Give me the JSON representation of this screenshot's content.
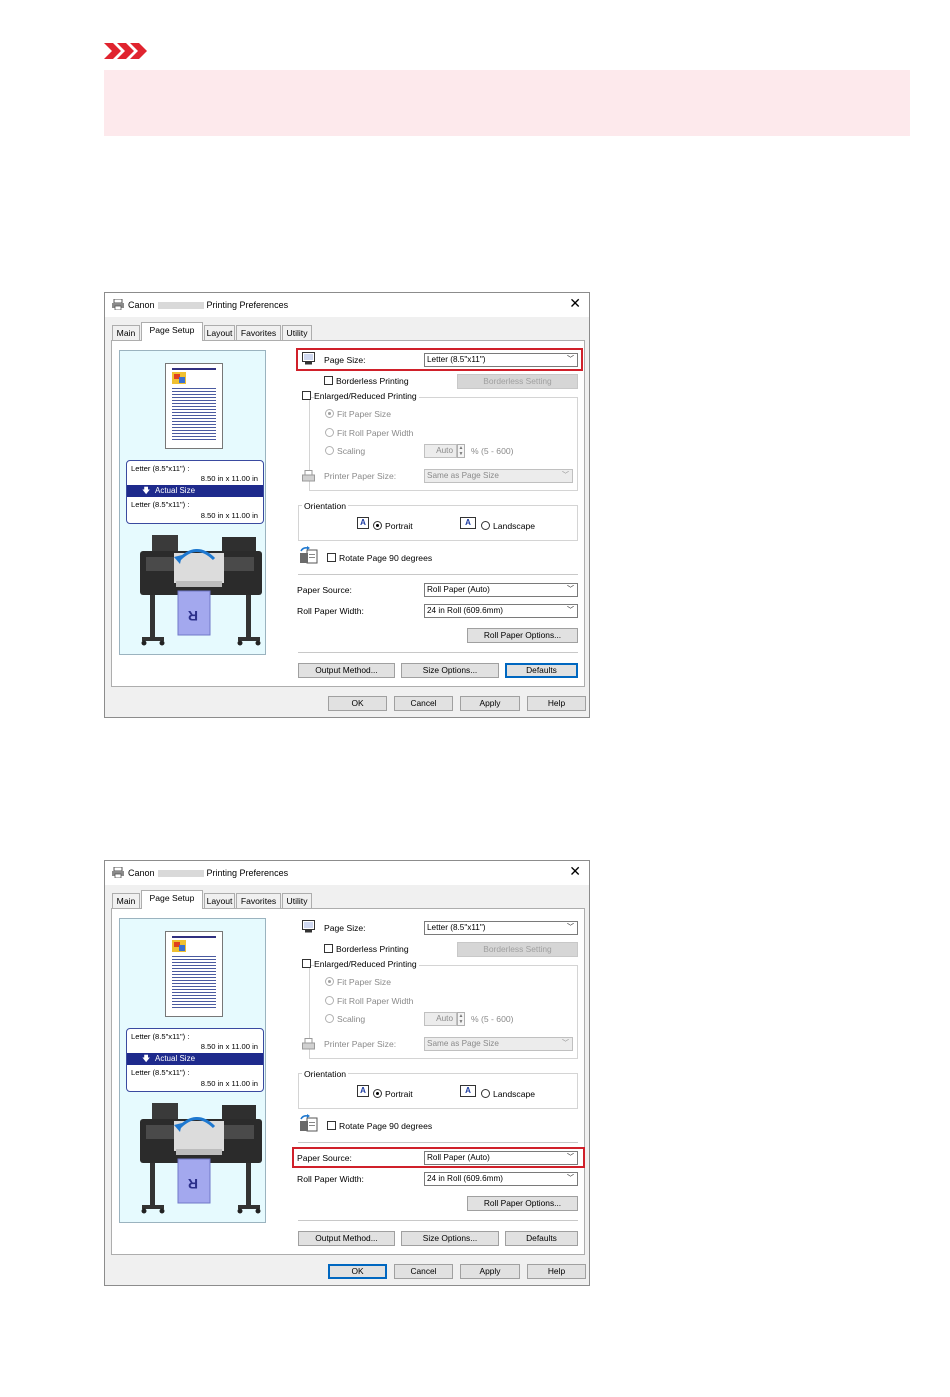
{
  "colors": {
    "note_bg": "#fde9ec",
    "note_icon": "#e0242f",
    "highlight": "#d0202a",
    "preview_bg": "#e6fafe",
    "accent": "#1e2a8c"
  },
  "icons": {
    "note": "important-chevrons-icon",
    "printer": "printer-icon",
    "close": "close-icon",
    "page_size": "monitor-icon",
    "orientation": "letter-a-icon",
    "rotate": "rotate-page-icon",
    "dropdown": "chevron-down-icon"
  },
  "dialog": {
    "title_prefix": "Canon",
    "title_suffix": "Printing Preferences",
    "close_glyph": "✕",
    "tabs": [
      "Main",
      "Page Setup",
      "Layout",
      "Favorites",
      "Utility"
    ],
    "active_tab": "Page Setup",
    "preview": {
      "line1": "Letter (8.5\"x11\") :",
      "line2": "8.50 in x 11.00 in",
      "bar_arrow": "🡇",
      "bar_label": "Actual Size",
      "line3": "Letter (8.5\"x11\") :",
      "line4": "8.50 in x 11.00 in"
    },
    "page_size_label": "Page Size:",
    "page_size_value": "Letter (8.5\"x11\")",
    "borderless_label": "Borderless Printing",
    "borderless_setting_button": "Borderless Setting",
    "enlarged_label": "Enlarged/Reduced Printing",
    "fit_paper_size": "Fit Paper Size",
    "fit_roll_width": "Fit Roll Paper Width",
    "scaling_label": "Scaling",
    "scaling_value": "Auto",
    "scaling_range": "% (5 - 600)",
    "printer_paper_size_label": "Printer Paper Size:",
    "printer_paper_size_value": "Same as Page Size",
    "orientation_label": "Orientation",
    "portrait_label": "Portrait",
    "landscape_label": "Landscape",
    "rotate_label": "Rotate Page 90 degrees",
    "paper_source_label": "Paper Source:",
    "paper_source_value": "Roll Paper (Auto)",
    "roll_width_label": "Roll Paper Width:",
    "roll_width_value": "24 in Roll (609.6mm)",
    "roll_options_button": "Roll Paper Options...",
    "output_method_button": "Output Method...",
    "size_options_button": "Size Options...",
    "defaults_button": "Defaults",
    "ok_button": "OK",
    "cancel_button": "Cancel",
    "apply_button": "Apply",
    "help_button": "Help"
  }
}
